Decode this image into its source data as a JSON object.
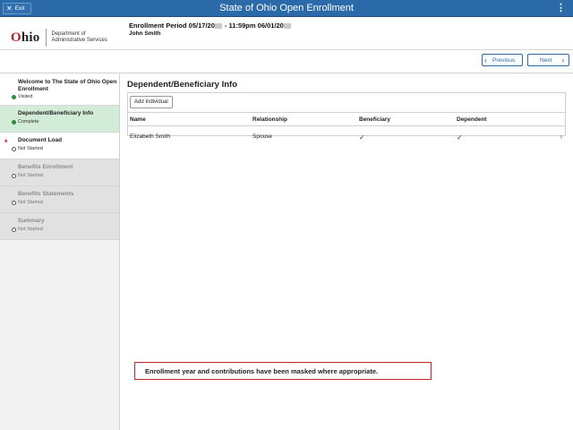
{
  "titlebar": {
    "exit_label": "Exit",
    "title": "State of Ohio Open Enrollment",
    "menu_icon": "kebab-menu-icon"
  },
  "header": {
    "logo_word": "Ohio",
    "logo_line1": "Department of",
    "logo_line2": "Administrative Services",
    "period_prefix": "Enrollment Period 05/17/20",
    "period_middle": " - 11:59pm 06/01/20",
    "user_name": "John Smith"
  },
  "nav": {
    "previous_label": "Previous",
    "next_label": "Next"
  },
  "sidebar": {
    "steps": [
      {
        "title": "Welcome to The State of Ohio Open Enrollment",
        "status": "Visited"
      },
      {
        "title": "Dependent/Beneficiary Info",
        "status": "Complete"
      },
      {
        "title": "Document Load",
        "status": "Not Started"
      },
      {
        "title": "Benefits Enrollment",
        "status": "Not Started"
      },
      {
        "title": "Benefits Statements",
        "status": "Not Started"
      },
      {
        "title": "Summary",
        "status": "Not Started"
      }
    ]
  },
  "main": {
    "section_title": "Dependent/Beneficiary Info",
    "add_button": "Add Individual",
    "columns": [
      "Name",
      "Relationship",
      "Beneficiary",
      "Dependent"
    ],
    "rows": [
      {
        "name": "Elizabeth Smith",
        "relationship": "Spouse",
        "beneficiary": "✓",
        "dependent": "✓"
      }
    ],
    "notice": "Enrollment year and contributions have been masked where appropriate."
  },
  "colors": {
    "titlebar": "#2b6aa8",
    "active_step": "#d3ecd7",
    "notice_border": "#c0282d"
  }
}
